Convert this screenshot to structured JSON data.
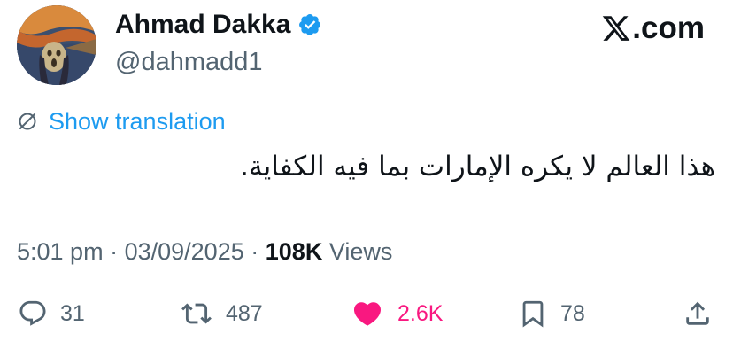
{
  "author": {
    "display_name": "Ahmad Dakka",
    "handle": "@dahmadd1",
    "verified": true
  },
  "brand": {
    "logo_icon": "x-logo-icon",
    "suffix": ".com"
  },
  "translation": {
    "icon": "globe-translate-icon",
    "label": "Show translation"
  },
  "tweet": {
    "text": "هذا العالم لا يكره الإمارات بما فيه الكفاية.",
    "time": "5:01 pm",
    "separator": "·",
    "date": "03/09/2025",
    "views_count": "108K",
    "views_label": "Views"
  },
  "actions": {
    "reply": {
      "icon": "reply-icon",
      "count": "31"
    },
    "retweet": {
      "icon": "retweet-icon",
      "count": "487"
    },
    "like": {
      "icon": "heart-icon",
      "count": "2.6K",
      "active": true
    },
    "bookmark": {
      "icon": "bookmark-icon",
      "count": "78"
    },
    "share": {
      "icon": "share-icon"
    }
  },
  "colors": {
    "link_blue": "#1d9bf0",
    "like_pink": "#f91880",
    "muted_text": "#536471",
    "primary_text": "#0f1419",
    "verified_blue": "#1d9bf0"
  }
}
